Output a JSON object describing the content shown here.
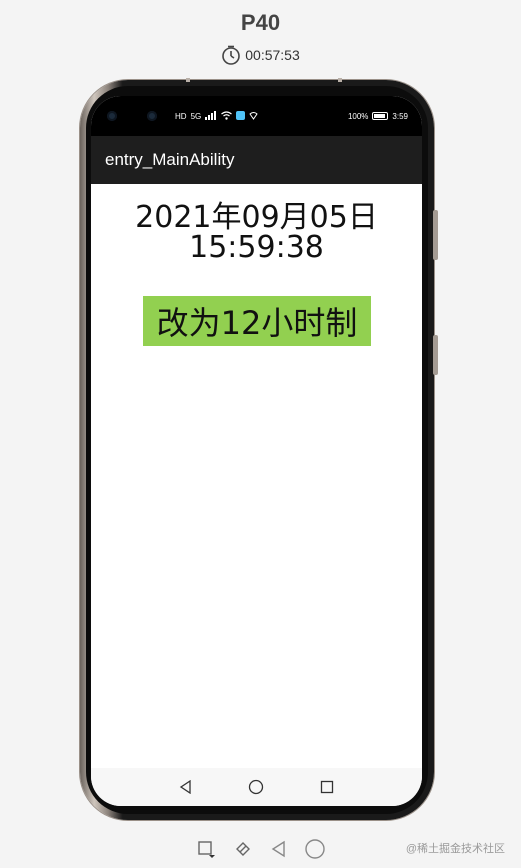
{
  "header": {
    "device_name": "P40",
    "elapsed_time": "00:57:53"
  },
  "statusbar": {
    "network_label": "HD",
    "signal_label": "5G",
    "battery_percent": "100%",
    "clock": "3:59"
  },
  "app": {
    "title": "entry_MainAbility",
    "date": "2021年09月05日",
    "time": "15:59:38",
    "toggle_button_label": "改为12小时制",
    "toggle_button_color": "#92d050"
  },
  "navbar": {
    "icons": [
      "back-icon",
      "home-icon",
      "recents-icon"
    ]
  },
  "toolbar": {
    "icons": [
      "rotate-icon",
      "screenshot-icon",
      "back-icon",
      "home-icon"
    ]
  },
  "watermark": "@稀土掘金技术社区"
}
